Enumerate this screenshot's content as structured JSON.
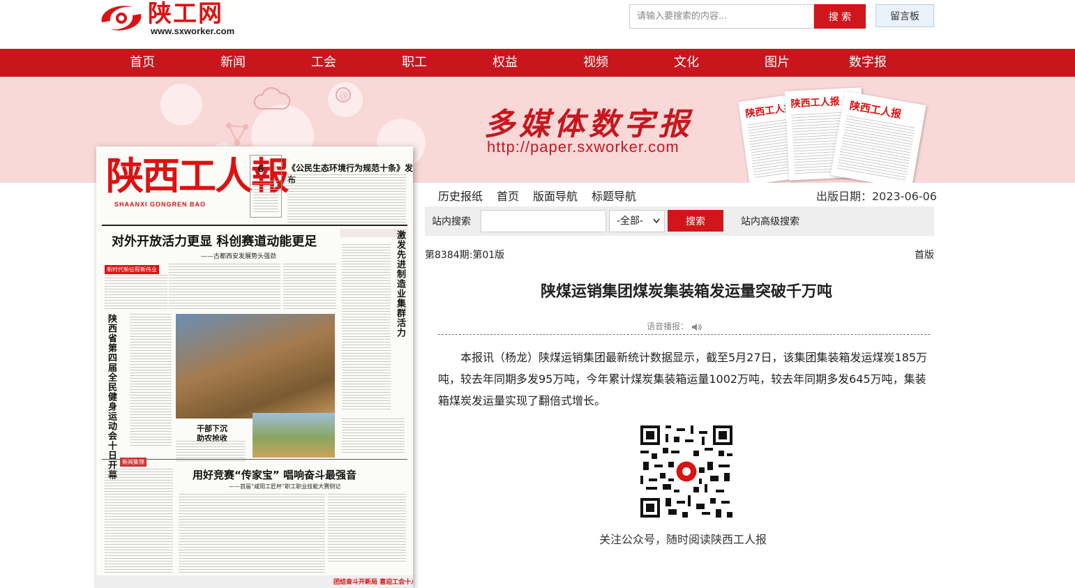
{
  "header": {
    "logo_text": "陕工网",
    "logo_url": "www.sxworker.com",
    "search_placeholder": "请输入要搜索的内容...",
    "search_label": "搜 索",
    "guestbook_label": "留言板"
  },
  "nav": {
    "items": [
      {
        "label": "首页"
      },
      {
        "label": "新闻"
      },
      {
        "label": "工会"
      },
      {
        "label": "职工"
      },
      {
        "label": "权益"
      },
      {
        "label": "视频"
      },
      {
        "label": "文化"
      },
      {
        "label": "图片"
      },
      {
        "label": "数字报"
      }
    ]
  },
  "banner": {
    "title": "多媒体数字报",
    "url": "http://paper.sxworker.com"
  },
  "paper_image": {
    "masthead": "陕西工人報",
    "masthead_en": "SHAANXI GONGREN BAO",
    "day": "6",
    "headline_1": "《公民生态环境行为规范十条》发布",
    "headline_2": "对外开放活力更显 科创赛道动能更足",
    "subhead_2": "——古都西安发展势头强劲",
    "vertical_1": "陕西省第四届全民健身运动会十日开幕",
    "vertical_2": "激发先进制造业集群活力",
    "photo_caption": "干部下沉 助农抢收",
    "headline_3": "用好竞赛“传家宝” 唱响奋斗最强音",
    "subhead_3": "——首届“咸阳工匠杯”职工职业技能大赛侧记",
    "footer_banner": "团结奋斗开新局 喜迎工会十八大"
  },
  "reader": {
    "tabs": [
      {
        "label": "历史报纸"
      },
      {
        "label": "首页"
      },
      {
        "label": "版面导航"
      },
      {
        "label": "标题导航"
      }
    ],
    "pub_date": "出版日期：2023-06-06",
    "site_search_label": "站内搜索",
    "site_search_scope": "-全部-",
    "site_search_btn": "搜索",
    "advanced_search": "站内高级搜索",
    "edition": "第8384期:第01版",
    "edition_right": "首版",
    "article_title": "陕煤运销集团煤炭集装箱发运量突破千万吨",
    "speech_label": "语音播报：",
    "body": "本报讯（杨龙）陕煤运销集团最新统计数据显示，截至5月27日，该集团集装箱发运煤炭185万吨，较去年同期多发95万吨，今年累计煤炭集装箱运量1002万吨，较去年同期多发645万吨，集装箱煤炭发运量实现了翻倍式增长。",
    "qr_caption": "关注公众号，随时阅读陕西工人报"
  },
  "colors": {
    "brand_red": "#c8161d",
    "banner_pink": "#f9d8d8"
  }
}
